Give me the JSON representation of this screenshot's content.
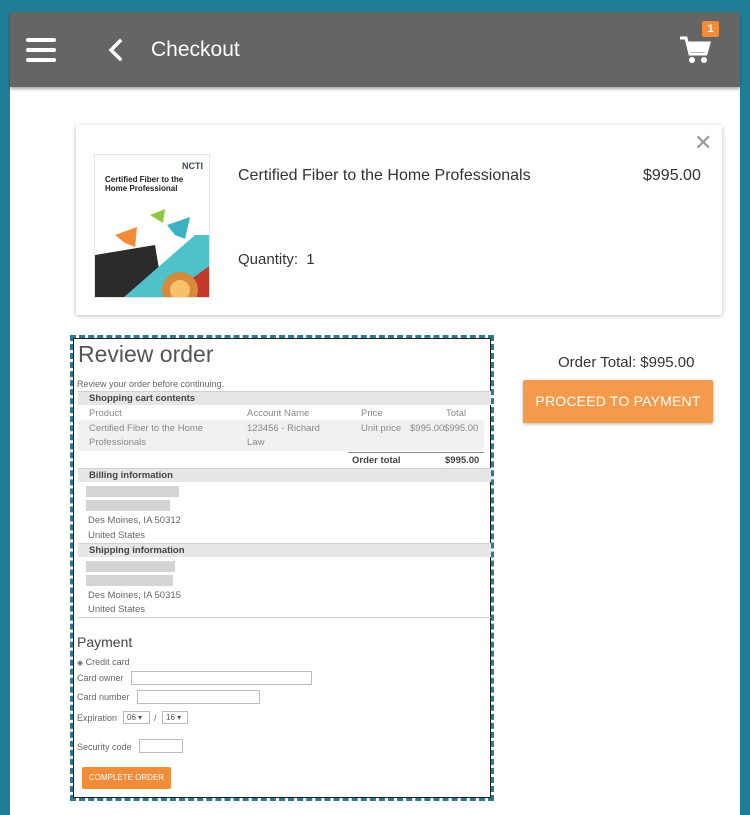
{
  "header": {
    "title": "Checkout",
    "cart_count": "1"
  },
  "cart_item": {
    "cover_brand": "NCTI",
    "cover_title": "Certified Fiber to the Home Professional",
    "name": "Certified Fiber to the Home Professionals",
    "price": "$995.00",
    "quantity_label": "Quantity:",
    "quantity": "1"
  },
  "summary": {
    "order_total_label": "Order Total:",
    "order_total": "$995.00",
    "proceed_label": "PROCEED TO PAYMENT"
  },
  "review": {
    "title": "Review order",
    "subtitle": "Review your order before continuing.",
    "cart_section": "Shopping cart contents",
    "columns": [
      "Product",
      "Account Name",
      "Price",
      "Total"
    ],
    "row": {
      "product_line1": "Certified Fiber to the Home",
      "product_line2": "Professionals",
      "account_line1": "123456 - Richard",
      "account_line2": "Law",
      "price_label": "Unit price",
      "price": "$995.00",
      "total": "$995.00"
    },
    "order_total_label": "Order total",
    "order_total": "$995.00",
    "billing_section": "Billing information",
    "billing_city": "Des Moines, IA 50312",
    "billing_country": "United States",
    "shipping_section": "Shipping information",
    "shipping_city": "Des Moines, IA 50315",
    "shipping_country": "United States",
    "payment_title": "Payment",
    "payment_method": "Credit card",
    "card_owner_label": "Card owner",
    "card_number_label": "Card number",
    "expiration_label": "Expiration",
    "exp_month": "06",
    "exp_separator": "/",
    "exp_year": "16",
    "security_code_label": "Security code",
    "complete_label": "COMPLETE ORDER"
  },
  "colors": {
    "header_bg": "#656565",
    "frame": "#1f7e97",
    "accent": "#f5994a"
  }
}
